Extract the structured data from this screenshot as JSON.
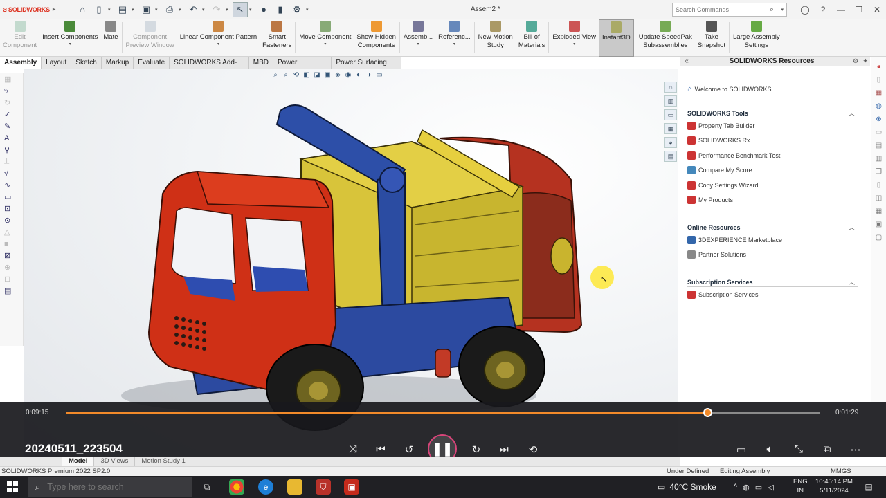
{
  "app": {
    "brand": "SOLIDWORKS",
    "doc_title": "Assem2 *",
    "search_placeholder": "Search Commands"
  },
  "ribbon": [
    {
      "id": "edit-component",
      "label": "Edit\nComponent",
      "disabled": true,
      "color": "#6a8"
    },
    {
      "id": "insert-components",
      "label": "Insert Components",
      "disabled": false,
      "dropdown": true,
      "color": "#4a8a3a"
    },
    {
      "id": "mate",
      "label": "Mate",
      "disabled": false,
      "color": "#888"
    },
    {
      "id": "component-preview-window",
      "label": "Component\nPreview Window",
      "disabled": true,
      "color": "#9ab"
    },
    {
      "id": "linear-component-pattern",
      "label": "Linear Component Pattern",
      "disabled": false,
      "dropdown": true,
      "color": "#c84"
    },
    {
      "id": "smart-fasteners",
      "label": "Smart\nFasteners",
      "disabled": false,
      "color": "#b74"
    },
    {
      "id": "move-component",
      "label": "Move Component",
      "disabled": false,
      "dropdown": true,
      "color": "#8a7"
    },
    {
      "id": "show-hidden-components",
      "label": "Show Hidden\nComponents",
      "disabled": false,
      "color": "#e93"
    },
    {
      "id": "assembly",
      "label": "Assemb...",
      "disabled": false,
      "dropdown": true,
      "color": "#779"
    },
    {
      "id": "reference",
      "label": "Referenc...",
      "disabled": false,
      "dropdown": true,
      "color": "#68b"
    },
    {
      "id": "new-motion-study",
      "label": "New Motion\nStudy",
      "disabled": false,
      "color": "#a96"
    },
    {
      "id": "bill-of-materials",
      "label": "Bill of\nMaterials",
      "disabled": false,
      "color": "#5a9"
    },
    {
      "id": "exploded-view",
      "label": "Exploded View",
      "disabled": false,
      "dropdown": true,
      "color": "#c55"
    },
    {
      "id": "instant3d",
      "label": "Instant3D",
      "disabled": false,
      "active": true,
      "color": "#aa6"
    },
    {
      "id": "update-speedpak",
      "label": "Update SpeedPak\nSubassemblies",
      "disabled": false,
      "color": "#7a5"
    },
    {
      "id": "take-snapshot",
      "label": "Take\nSnapshot",
      "disabled": false,
      "color": "#555"
    },
    {
      "id": "large-assembly-settings",
      "label": "Large Assembly\nSettings",
      "disabled": false,
      "color": "#6a4"
    }
  ],
  "tabs": [
    "Assembly",
    "Layout",
    "Sketch",
    "Markup",
    "Evaluate",
    "SOLIDWORKS Add-Ins",
    "MBD",
    "Power Surfacing",
    "Power Surfacing RE"
  ],
  "active_tab": "Assembly",
  "resources": {
    "title": "SOLIDWORKS Resources",
    "welcome": "Welcome to SOLIDWORKS",
    "sections": [
      {
        "title": "SOLIDWORKS Tools",
        "items": [
          {
            "label": "Property Tab Builder",
            "color": "#c33"
          },
          {
            "label": "SOLIDWORKS Rx",
            "color": "#c33"
          },
          {
            "label": "Performance Benchmark Test",
            "color": "#c33"
          },
          {
            "label": "Compare My Score",
            "color": "#48b"
          },
          {
            "label": "Copy Settings Wizard",
            "color": "#c33"
          },
          {
            "label": "My Products",
            "color": "#c33"
          }
        ]
      },
      {
        "title": "Online Resources",
        "items": [
          {
            "label": "3DEXPERIENCE Marketplace",
            "color": "#36a"
          },
          {
            "label": "Partner Solutions",
            "color": "#888"
          }
        ]
      },
      {
        "title": "Subscription Services",
        "items": [
          {
            "label": "Subscription Services",
            "color": "#c33"
          }
        ]
      }
    ]
  },
  "player": {
    "current_time": "0:09:15",
    "total_time": "0:01:29",
    "progress": 0.85,
    "video_title": "20240511_223504",
    "accent": "#f28a2a"
  },
  "model_tabs": [
    "Model",
    "3D Views",
    "Motion Study 1"
  ],
  "active_model_tab": "Model",
  "status": {
    "product": "SOLIDWORKS Premium 2022 SP2.0",
    "definition": "Under Defined",
    "mode": "Editing Assembly",
    "units": "MMGS"
  },
  "taskbar": {
    "search_placeholder": "Type here to search",
    "weather": "40°C  Smoke",
    "lang": "ENG",
    "region": "IN",
    "time": "10:45:14 PM",
    "date": "5/11/2024"
  }
}
